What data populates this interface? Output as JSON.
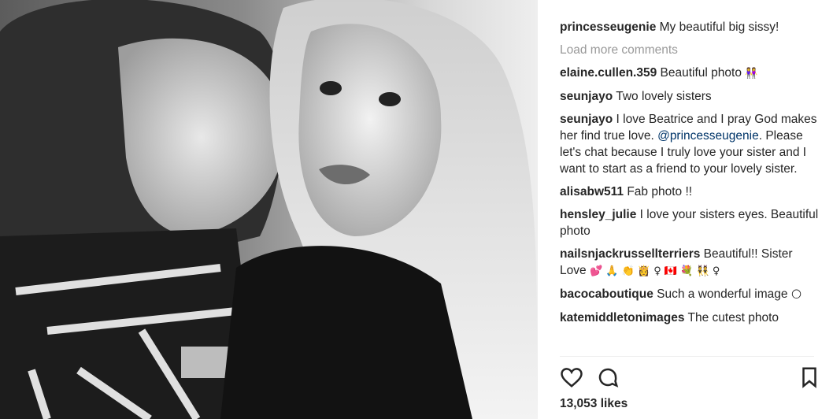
{
  "post": {
    "caption_user": "princesseugenie",
    "caption_text": "My beautiful big sissy!",
    "load_more": "Load more comments",
    "comments": [
      {
        "user": "elaine.cullen.359",
        "text": "Beautiful photo",
        "emoji": "👭"
      },
      {
        "user": "seunjayo",
        "text": "Two lovely sisters"
      },
      {
        "user": "seunjayo",
        "text": "I love Beatrice and I pray God makes her find true love.",
        "mention": "@princesseugenie",
        "text2": ". Please let's chat because I truly love your sister and I want to start as a friend to your lovely sister."
      },
      {
        "user": "alisabw511",
        "text": "Fab photo !!"
      },
      {
        "user": "hensley_julie",
        "text": "I love your sisters eyes. Beautiful photo"
      },
      {
        "user": "nailsnjackrussellterriers",
        "text": "Beautiful!! Sister Love",
        "emoji": "💕 🙏 👏 👸 ♀ 🇨🇦 💐 👯 ♀"
      },
      {
        "user": "bacocaboutique",
        "text": "Such a wonderful image",
        "emoji": "🌕"
      },
      {
        "user": "katemiddletonimages",
        "text": "The cutest photo"
      }
    ],
    "likes": "13,053 likes"
  },
  "icons": [
    "heart-icon",
    "comment-icon",
    "bookmark-icon"
  ]
}
